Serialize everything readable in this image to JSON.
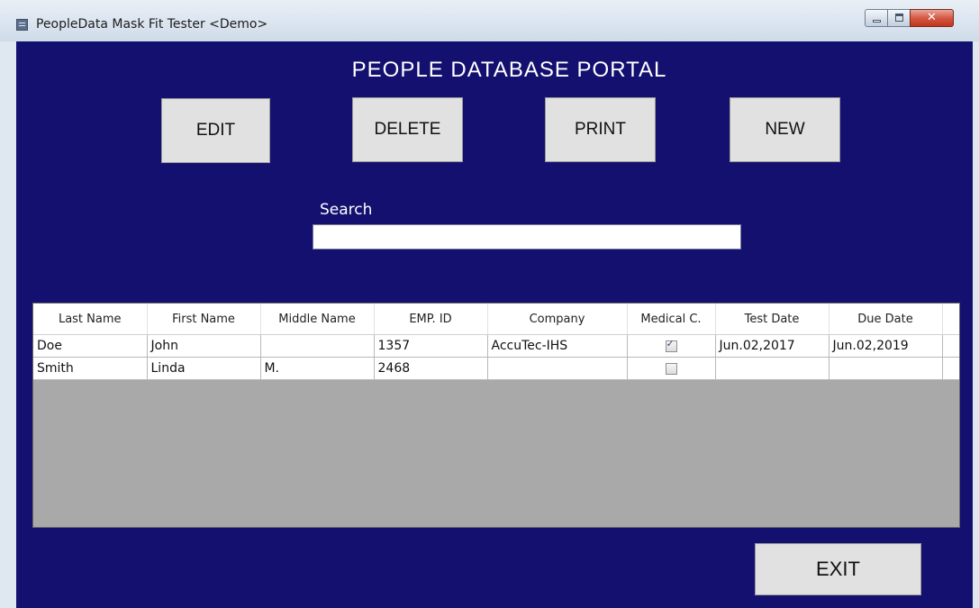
{
  "window": {
    "title": "PeopleData Mask Fit Tester <Demo>"
  },
  "portal": {
    "title": "PEOPLE DATABASE PORTAL"
  },
  "toolbar": {
    "edit_label": "EDIT",
    "delete_label": "DELETE",
    "print_label": "PRINT",
    "new_label": "NEW"
  },
  "search": {
    "label": "Search",
    "value": ""
  },
  "table": {
    "columns": [
      "Last Name",
      "First Name",
      "Middle Name",
      "EMP. ID",
      "Company",
      "Medical C.",
      "Test Date",
      "Due Date"
    ],
    "rows": [
      {
        "last_name": "Doe",
        "first_name": "John",
        "middle_name": "",
        "emp_id": "1357",
        "company": "AccuTec-IHS",
        "medical_checked": true,
        "test_date": "Jun.02,2017",
        "due_date": "Jun.02,2019"
      },
      {
        "last_name": "Smith",
        "first_name": "Linda",
        "middle_name": "M.",
        "emp_id": "2468",
        "company": "",
        "medical_checked": false,
        "test_date": "",
        "due_date": ""
      }
    ]
  },
  "footer": {
    "exit_label": "EXIT"
  },
  "colors": {
    "background": "#13106f",
    "button": "#e1e1e1",
    "grid_empty": "#a9a9a9"
  }
}
